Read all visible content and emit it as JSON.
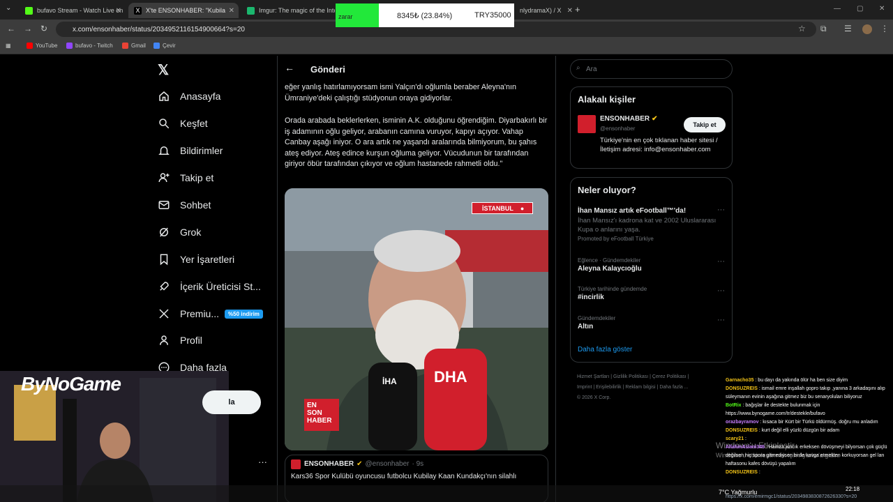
{
  "browser": {
    "tabs": [
      {
        "label": "bufavo Stream - Watch Live on",
        "color": "#53fc18"
      },
      {
        "label": "X'te ENSONHABER: \"Kubila",
        "color": "#ffffff"
      },
      {
        "label": "Imgur: The magic of the Intern",
        "color": "#1bb76e"
      }
    ],
    "partial_tab": "nlydramaX) / X",
    "url": "x.com/ensonhaber/status/2034952116154900664?s=20",
    "bookmarks": [
      "YouTube",
      "bufavo - Twitch",
      "Gmail",
      "Çevir"
    ]
  },
  "ticker": {
    "status": "zarar",
    "amount": "8345₺ (23.84%)",
    "total": "TRY35000"
  },
  "sidebar": {
    "items": [
      {
        "label": "Anasayfa",
        "icon": "home-icon"
      },
      {
        "label": "Keşfet",
        "icon": "search-icon"
      },
      {
        "label": "Bildirimler",
        "icon": "bell-icon"
      },
      {
        "label": "Takip et",
        "icon": "person-add-icon"
      },
      {
        "label": "Sohbet",
        "icon": "mail-icon"
      },
      {
        "label": "Grok",
        "icon": "grok-icon"
      },
      {
        "label": "Yer İşaretleri",
        "icon": "bookmark-icon"
      },
      {
        "label": "İçerik Üreticisi St...",
        "icon": "rocket-icon"
      },
      {
        "label": "Premiu...",
        "icon": "x-icon"
      },
      {
        "label": "Profil",
        "icon": "person-icon"
      },
      {
        "label": "Daha fazla",
        "icon": "more-icon"
      }
    ],
    "premium_badge": "%50 indirim",
    "post_button_partial": "la"
  },
  "main": {
    "header": "Gönderi",
    "paragraphs": [
      "eğer yanlış hatırlamıyorsam ismi Yalçın'dı oğlumla beraber Aleyna'nın Ümraniye'deki çalıştığı stüdyonun oraya gidiyorlar.",
      "Orada arabada beklerlerken, isminin A.K. olduğunu öğrendiğim. Diyarbakırlı bir iş adamının oğlu geliyor, arabanın camına vuruyor, kapıyı açıyor. Vahap Canbay aşağı iniyor. O ara artık ne yaşandı aralarında bilmiyorum, bu şahıs ateş ediyor. Ateş edince kurşun oğluma geliyor. Vücudunun bir tarafından giriyor öbür tarafından çıkıyor ve oğlum hastanede rahmetli oldu.\""
    ],
    "media_tag": "İSTANBUL",
    "media_logo": [
      "EN",
      "SON",
      "HABER"
    ],
    "mic_labels": [
      "İHA",
      "DHA"
    ],
    "quote": {
      "name": "ENSONHABER",
      "handle": "@ensonhaber",
      "time": "· 9s",
      "text": "Kars36 Spor Kulübü oyuncusu futbolcu Kubilay Kaan Kundakçı'nın silahlı"
    }
  },
  "right": {
    "search_placeholder": "Ara",
    "related": {
      "title": "Alakalı kişiler",
      "name": "ENSONHABER",
      "handle": "@ensonhaber",
      "follow": "Takip et",
      "bio": "Türkiye'nin en çok tıklanan haber sitesi / İletişim adresi: info@ensonhaber.com"
    },
    "trends": {
      "title": "Neler oluyor?",
      "items": [
        {
          "meta": "",
          "title": "İhan Mansız artık eFootball™'da!",
          "sub": "İhan Mansız'ı kadrona kat ve 2002 Uluslararası Kupa o anlarını yaşa.",
          "promo": "Promoted by eFootball Türkiye"
        },
        {
          "meta": "Eğlence · Gündemdekiler",
          "title": "Aleyna Kalaycıoğlu",
          "sub": "",
          "promo": ""
        },
        {
          "meta": "Türkiye tarihinde gündemde",
          "title": "#incirlik",
          "sub": "",
          "promo": ""
        },
        {
          "meta": "Gündemdekiler",
          "title": "Altın",
          "sub": "",
          "promo": ""
        }
      ],
      "more": "Daha fazla göster"
    },
    "footer": [
      "Hizmet Şartları",
      "Gizlilik Politikası",
      "Çerez Politikası",
      "Imprint",
      "Erişilebilirlik",
      "Reklam bilgisi",
      "Daha fazla ...",
      "© 2026 X Corp."
    ]
  },
  "overlay": {
    "brand": "ByNoGame",
    "chat": [
      {
        "user": "Garnacho35",
        "color": "#f5c518",
        "text": ": bu dayı da yakında ölür ha ben size diyim"
      },
      {
        "user": "DONSUZREIS",
        "color": "#f5c518",
        "text": ": ismail emre inşallah gopro takıp ,yanına 3 arkadaşını alıp süleymanın evinin aşağına gitmez biz bu senaryoluları biliyoruz"
      },
      {
        "user": "BotRix",
        "color": "#53fc18",
        "text": ": bağışlar ile destekte bulunmak için https://www.bynogame.com/tr/destekle/bufavo"
      },
      {
        "user": "orazbayramov",
        "color": "#c77dff",
        "text": ": kısaca bir Kürt bir Türkü öldürmüş. doğru mu anladım"
      },
      {
        "user": "DONSUZREIS",
        "color": "#f5c518",
        "text": ": kurt değil elli yüzlü düzgün bir adam"
      },
      {
        "user": "scary21",
        "color": "#f5c518",
        "text": ":"
      },
      {
        "user": "AllahinAslani346",
        "color": "#c77dff",
        "text": ": Hamza azıcık erkeksen dövüşmeyi bilyorsan çok güçlü değilsen hiç spora gitmediysen birde kavga etmekten korkuyorsan gel lan haftasonu kafes dövüşü yapalım"
      },
      {
        "user": "DONSUZREIS",
        "color": "#f5c518",
        "text": ":"
      }
    ],
    "watermark": [
      "Windows'u Etkinleştir",
      "Windows'u etkinleştirmek için Ayarlar'a gidin."
    ],
    "weather": "7°C Yağmurlu",
    "clock": "22:18",
    "status_url": "https://x.com/emirmgc1/status/2034983830872626330?s=20"
  }
}
